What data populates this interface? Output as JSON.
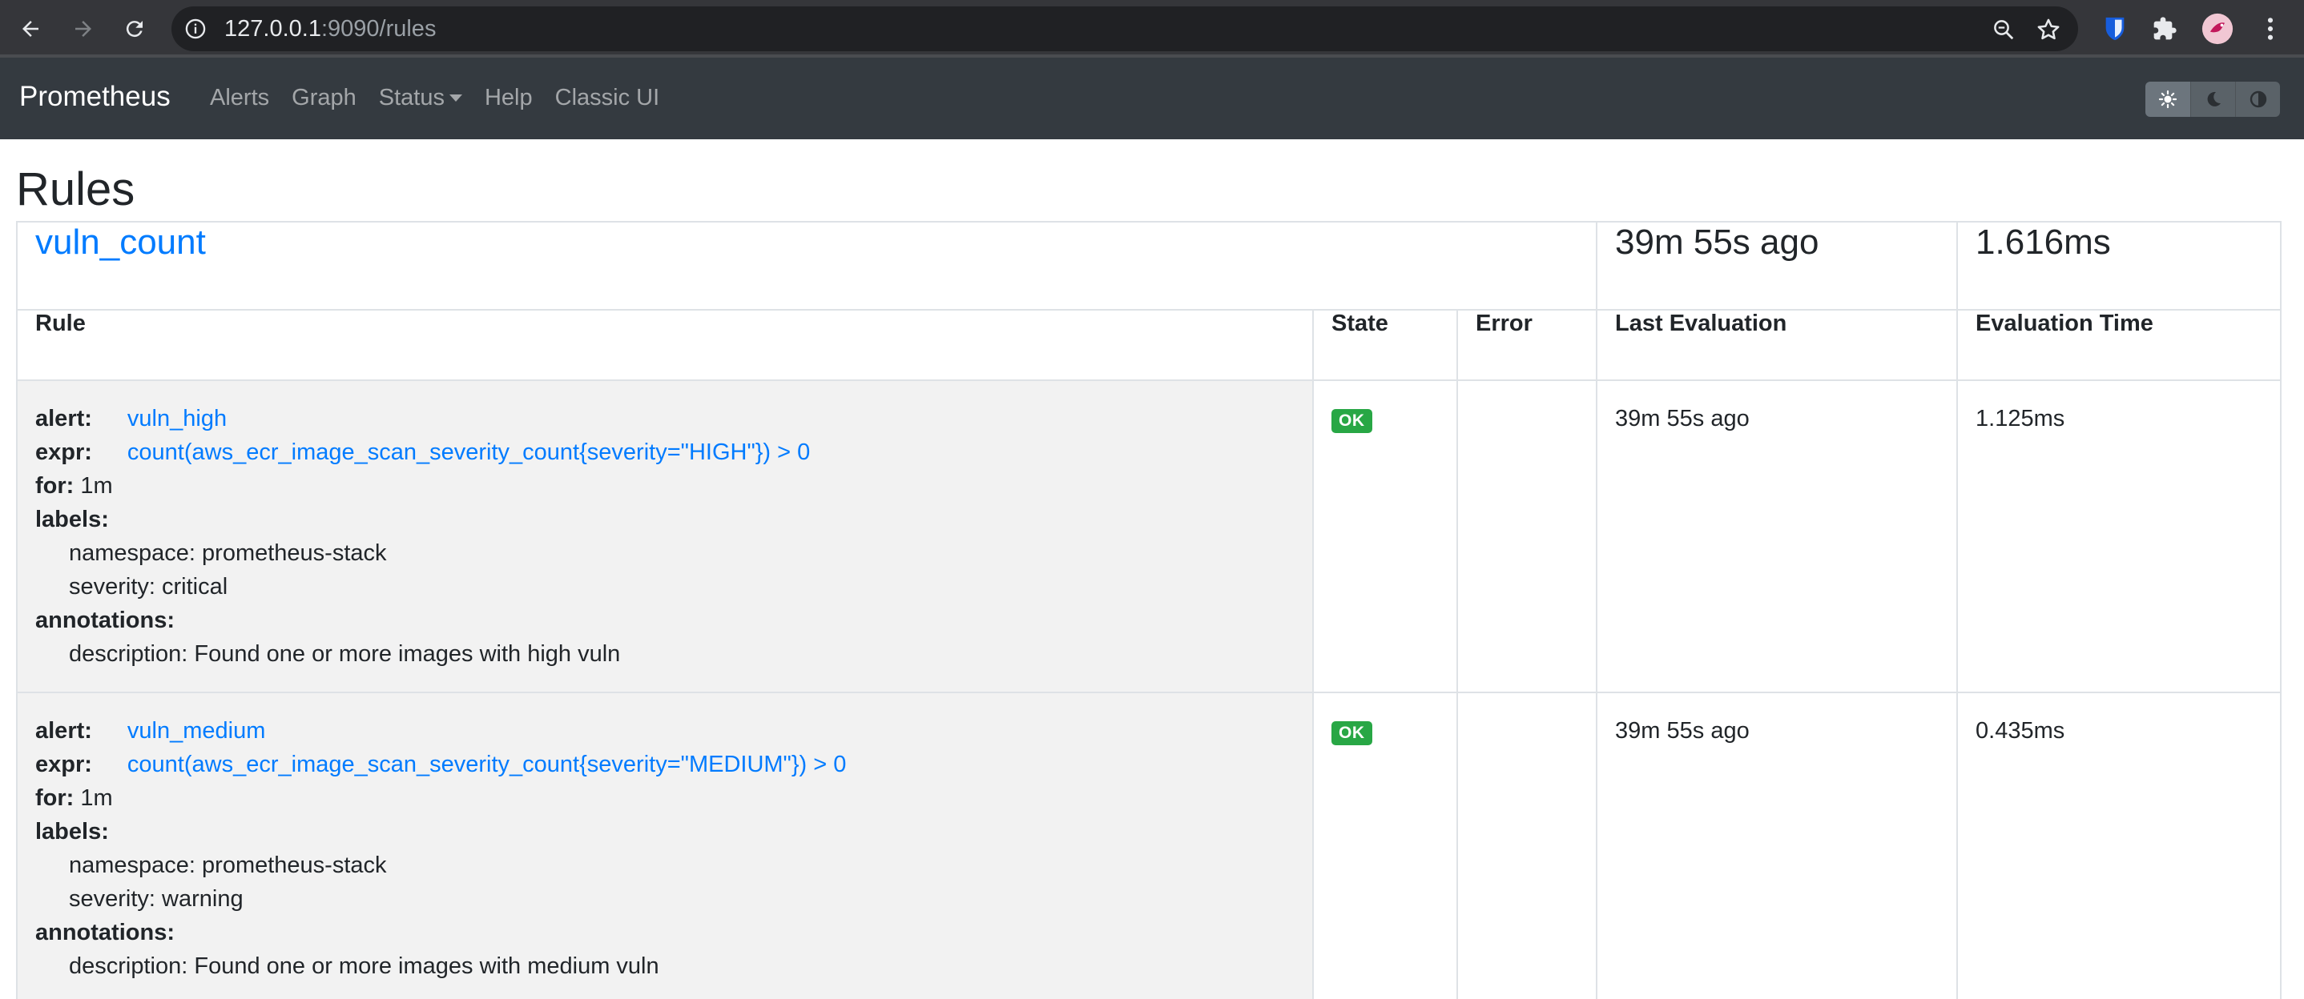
{
  "browser": {
    "url_host": "127.0.0.1",
    "url_path": ":9090/rules"
  },
  "navbar": {
    "brand": "Prometheus",
    "links": [
      "Alerts",
      "Graph",
      "Status",
      "Help",
      "Classic UI"
    ]
  },
  "page": {
    "title": "Rules"
  },
  "group": {
    "name": "vuln_count",
    "last_evaluation": "39m 55s ago",
    "evaluation_time": "1.616ms"
  },
  "table": {
    "headers": {
      "rule": "Rule",
      "state": "State",
      "error": "Error",
      "last_evaluation": "Last Evaluation",
      "evaluation_time": "Evaluation Time"
    }
  },
  "labels": {
    "alert": "alert:",
    "expr": "expr:",
    "for": "for:",
    "labels": "labels:",
    "annotations": "annotations:"
  },
  "rules": [
    {
      "alert": "vuln_high",
      "expr": "count(aws_ecr_image_scan_severity_count{severity=\"HIGH\"}) > 0",
      "for": "1m",
      "label_namespace": "namespace: prometheus-stack",
      "label_severity": "severity: critical",
      "annotation_description": "description: Found one or more images with high vuln",
      "state": "OK",
      "error": "",
      "last_evaluation": "39m 55s ago",
      "evaluation_time": "1.125ms"
    },
    {
      "alert": "vuln_medium",
      "expr": "count(aws_ecr_image_scan_severity_count{severity=\"MEDIUM\"}) > 0",
      "for": "1m",
      "label_namespace": "namespace: prometheus-stack",
      "label_severity": "severity: warning",
      "annotation_description": "description: Found one or more images with medium vuln",
      "state": "OK",
      "error": "",
      "last_evaluation": "39m 55s ago",
      "evaluation_time": "0.435ms"
    }
  ],
  "colors": {
    "navbar_bg": "#343a40",
    "link": "#007bff",
    "ok_badge": "#28a745",
    "row_bg": "#f2f2f2"
  }
}
